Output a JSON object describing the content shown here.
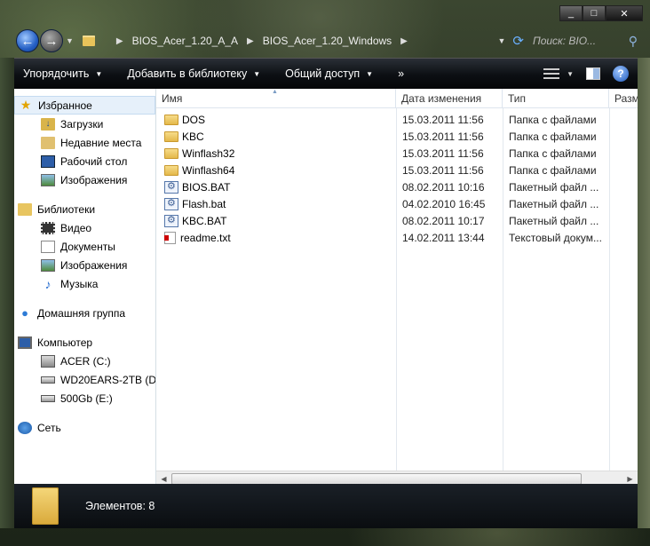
{
  "window": {
    "caption": {
      "minimize": "_",
      "maximize": "□",
      "close": "✕"
    }
  },
  "address": {
    "crumbs": [
      "BIOS_Acer_1.20_A_A",
      "BIOS_Acer_1.20_Windows"
    ],
    "search_placeholder": "Поиск: BIO..."
  },
  "toolbar": {
    "organize": "Упорядочить",
    "add_to_library": "Добавить в библиотеку",
    "share": "Общий доступ",
    "more": "»"
  },
  "nav": {
    "favorites": "Избранное",
    "favorites_items": [
      "Загрузки",
      "Недавние места",
      "Рабочий стол",
      "Изображения"
    ],
    "libraries": "Библиотеки",
    "libraries_items": [
      "Видео",
      "Документы",
      "Изображения",
      "Музыка"
    ],
    "homegroup": "Домашняя группа",
    "computer": "Компьютер",
    "computer_items": [
      "ACER (C:)",
      "WD20EARS-2TB (D:)",
      "500Gb (E:)"
    ],
    "network": "Сеть"
  },
  "columns": {
    "name": "Имя",
    "date": "Дата изменения",
    "type": "Тип",
    "size": "Разм"
  },
  "files": [
    {
      "name": "DOS",
      "date": "15.03.2011 11:56",
      "type": "Папка с файлами",
      "icon": "folder-icon"
    },
    {
      "name": "KBC",
      "date": "15.03.2011 11:56",
      "type": "Папка с файлами",
      "icon": "folder-icon"
    },
    {
      "name": "Winflash32",
      "date": "15.03.2011 11:56",
      "type": "Папка с файлами",
      "icon": "folder-icon"
    },
    {
      "name": "Winflash64",
      "date": "15.03.2011 11:56",
      "type": "Папка с файлами",
      "icon": "folder-icon"
    },
    {
      "name": "BIOS.BAT",
      "date": "08.02.2011 10:16",
      "type": "Пакетный файл ...",
      "icon": "batch-file-icon"
    },
    {
      "name": "Flash.bat",
      "date": "04.02.2010 16:45",
      "type": "Пакетный файл ...",
      "icon": "batch-file-icon"
    },
    {
      "name": "KBC.BAT",
      "date": "08.02.2011 10:17",
      "type": "Пакетный файл ...",
      "icon": "batch-file-icon"
    },
    {
      "name": "readme.txt",
      "date": "14.02.2011 13:44",
      "type": "Текстовый докум...",
      "icon": "text-file-icon"
    }
  ],
  "details": {
    "count": "Элементов: 8"
  }
}
